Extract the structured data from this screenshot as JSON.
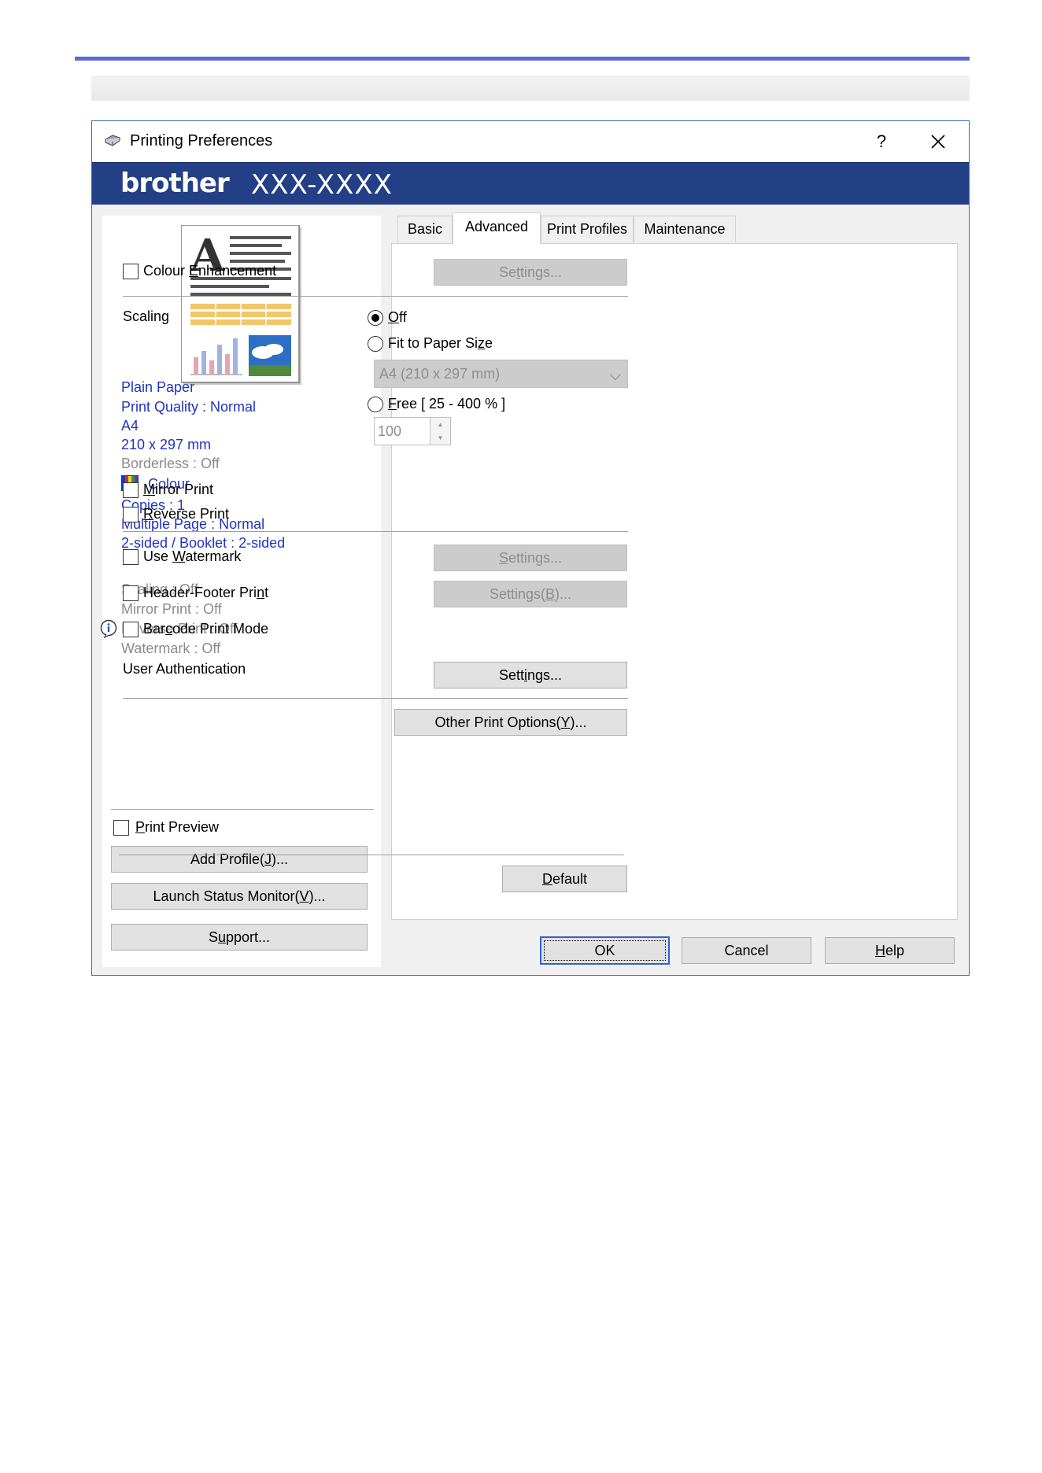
{
  "window": {
    "title": "Printing Preferences",
    "help_glyph": "?",
    "close_icon": "close-icon"
  },
  "banner": {
    "logo": "brother",
    "model": "XXX-XXXX"
  },
  "summary": {
    "media": "Plain Paper",
    "quality": "Print Quality : Normal",
    "paper": "A4",
    "paper_dims": "210 x 297 mm",
    "borderless": "Borderless : Off",
    "colour": "Colour",
    "copies": "Copies : 1",
    "multiple_page": "Multiple Page : Normal",
    "duplex": "2-sided / Booklet : 2-sided",
    "scaling": "Scaling : Off",
    "mirror": "Mirror Print : Off",
    "reverse": "Reverse Print : Off",
    "watermark": "Watermark : Off"
  },
  "left_controls": {
    "print_preview": {
      "pre": "",
      "u": "P",
      "post": "rint Preview",
      "checked": false
    },
    "add_profile": {
      "pre": "Add Profile(",
      "u": "J",
      "post": ")..."
    },
    "launch_status": {
      "pre": "Launch Status Monitor(",
      "u": "V",
      "post": ")..."
    },
    "support": {
      "pre": "S",
      "u": "u",
      "post": "pport..."
    }
  },
  "tabs": [
    {
      "label": "Basic",
      "active": false
    },
    {
      "label": "Advanced",
      "active": true
    },
    {
      "label": "Print Profiles",
      "active": false
    },
    {
      "label": "Maintenance",
      "active": false
    }
  ],
  "advanced": {
    "colour_enhancement": {
      "pre": "Colour ",
      "u": "E",
      "post": "nhancement",
      "checked": false
    },
    "colour_settings": {
      "pre": "Se",
      "u": "t",
      "post": "tings..."
    },
    "scaling_label": "Scaling",
    "scaling_off": {
      "pre": "",
      "u": "O",
      "post": "ff",
      "selected": true
    },
    "scaling_fit": {
      "pre": "Fit to Paper Si",
      "u": "z",
      "post": "e",
      "selected": false
    },
    "paper_size_select": "A4 (210 x 297 mm)",
    "scaling_free": {
      "pre": "",
      "u": "F",
      "post": "ree [ 25 - 400 % ]",
      "selected": false
    },
    "free_value": "100",
    "mirror_print": {
      "pre": "",
      "u": "M",
      "post": "irror Print",
      "checked": false
    },
    "reverse_print": {
      "pre": "",
      "u": "R",
      "post": "everse Print",
      "checked": false
    },
    "use_watermark": {
      "pre": "Use ",
      "u": "W",
      "post": "atermark",
      "checked": false
    },
    "watermark_settings": {
      "pre": "",
      "u": "S",
      "post": "ettings..."
    },
    "header_footer": {
      "pre": "Header-Footer Pri",
      "u": "n",
      "post": "t",
      "checked": false
    },
    "header_footer_settings": {
      "pre": "Settings(",
      "u": "B",
      "post": ")..."
    },
    "barcode_mode": {
      "pre": "Bar",
      "u": "c",
      "post": "ode Print Mode",
      "checked": false
    },
    "user_auth_label": "User Authentication",
    "user_auth_settings": {
      "pre": "Sett",
      "u": "i",
      "post": "ngs..."
    },
    "other_options": {
      "pre": "Other Print Options(",
      "u": "Y",
      "post": ")..."
    },
    "default_btn": {
      "pre": "",
      "u": "D",
      "post": "efault"
    }
  },
  "footer_buttons": {
    "ok": "OK",
    "cancel": "Cancel",
    "help": {
      "pre": "",
      "u": "H",
      "post": "elp"
    }
  },
  "colors": {
    "banner": "#233f86",
    "summary_text": "#1f33c2",
    "accent_rule": "#5b6bd3"
  }
}
